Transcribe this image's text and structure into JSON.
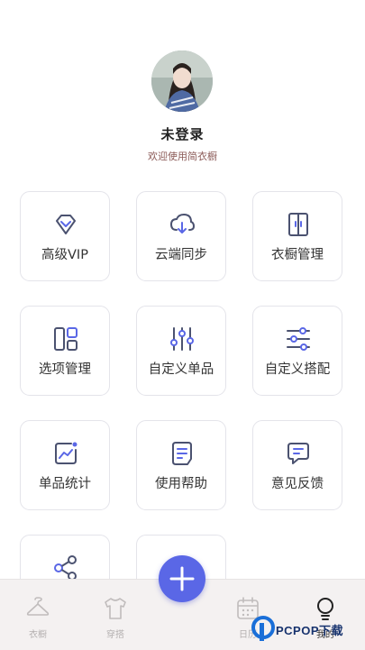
{
  "profile": {
    "username": "未登录",
    "welcome": "欢迎使用简衣橱"
  },
  "menu": [
    {
      "label": "高级VIP",
      "icon": "diamond-icon"
    },
    {
      "label": "云端同步",
      "icon": "cloud-download-icon"
    },
    {
      "label": "衣橱管理",
      "icon": "wardrobe-icon"
    },
    {
      "label": "选项管理",
      "icon": "layout-grid-icon"
    },
    {
      "label": "自定义单品",
      "icon": "sliders-vertical-icon"
    },
    {
      "label": "自定义搭配",
      "icon": "sliders-horizontal-icon"
    },
    {
      "label": "单品统计",
      "icon": "chart-icon"
    },
    {
      "label": "使用帮助",
      "icon": "document-icon"
    },
    {
      "label": "意见反馈",
      "icon": "feedback-icon"
    },
    {
      "label": "",
      "icon": "share-icon"
    },
    {
      "label": "",
      "icon": "settings-icon"
    }
  ],
  "nav": {
    "tabs": [
      {
        "label": "衣橱",
        "icon": "hanger-icon"
      },
      {
        "label": "穿搭",
        "icon": "shirt-icon"
      },
      {
        "label": "日历",
        "icon": "calendar-icon"
      },
      {
        "label": "我的",
        "icon": "lightbulb-icon"
      }
    ],
    "add_icon": "plus-icon"
  },
  "watermark": {
    "text": "PCPOP下载"
  },
  "colors": {
    "accent": "#5a67e6",
    "icon_stroke": "#4b5270",
    "welcome_text": "#8b5a57"
  }
}
